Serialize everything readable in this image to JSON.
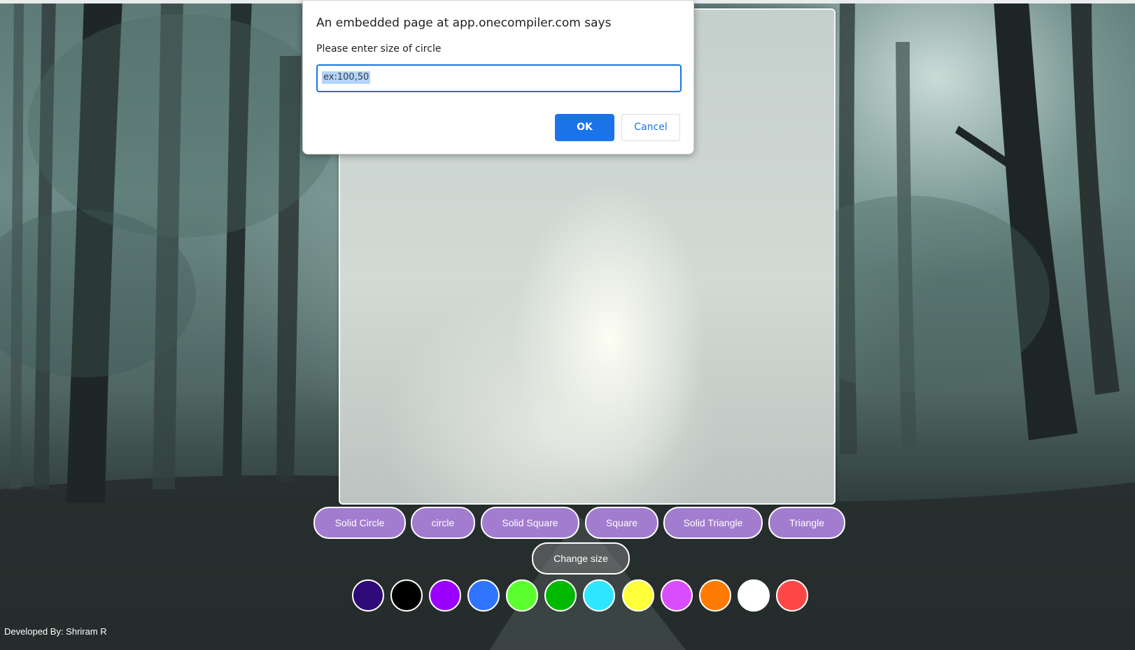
{
  "dialog": {
    "title": "An embedded page at app.onecompiler.com says",
    "message": "Please enter size of circle",
    "input_value": "ex:100,50",
    "ok_label": "OK",
    "cancel_label": "Cancel"
  },
  "shape_buttons": [
    {
      "label": "Solid Circle"
    },
    {
      "label": "circle"
    },
    {
      "label": "Solid Square"
    },
    {
      "label": "Square"
    },
    {
      "label": "Solid Triangle"
    },
    {
      "label": "Triangle"
    }
  ],
  "change_size_label": "Change size",
  "swatches": [
    {
      "name": "dark-purple",
      "color": "#2e0a78"
    },
    {
      "name": "black",
      "color": "#000000"
    },
    {
      "name": "violet",
      "color": "#9b00ff"
    },
    {
      "name": "blue",
      "color": "#2f74ff"
    },
    {
      "name": "light-green",
      "color": "#5cff2e"
    },
    {
      "name": "green",
      "color": "#00b800"
    },
    {
      "name": "cyan",
      "color": "#2ee6ff"
    },
    {
      "name": "yellow",
      "color": "#ffff3a"
    },
    {
      "name": "magenta",
      "color": "#d94dff"
    },
    {
      "name": "orange",
      "color": "#ff7a00"
    },
    {
      "name": "white",
      "color": "#ffffff"
    },
    {
      "name": "red",
      "color": "#ff4747"
    }
  ],
  "credit": "Developed By: Shriram R",
  "colors": {
    "shape_button_bg": "#a27ccf",
    "dialog_accent": "#1a73e8"
  }
}
